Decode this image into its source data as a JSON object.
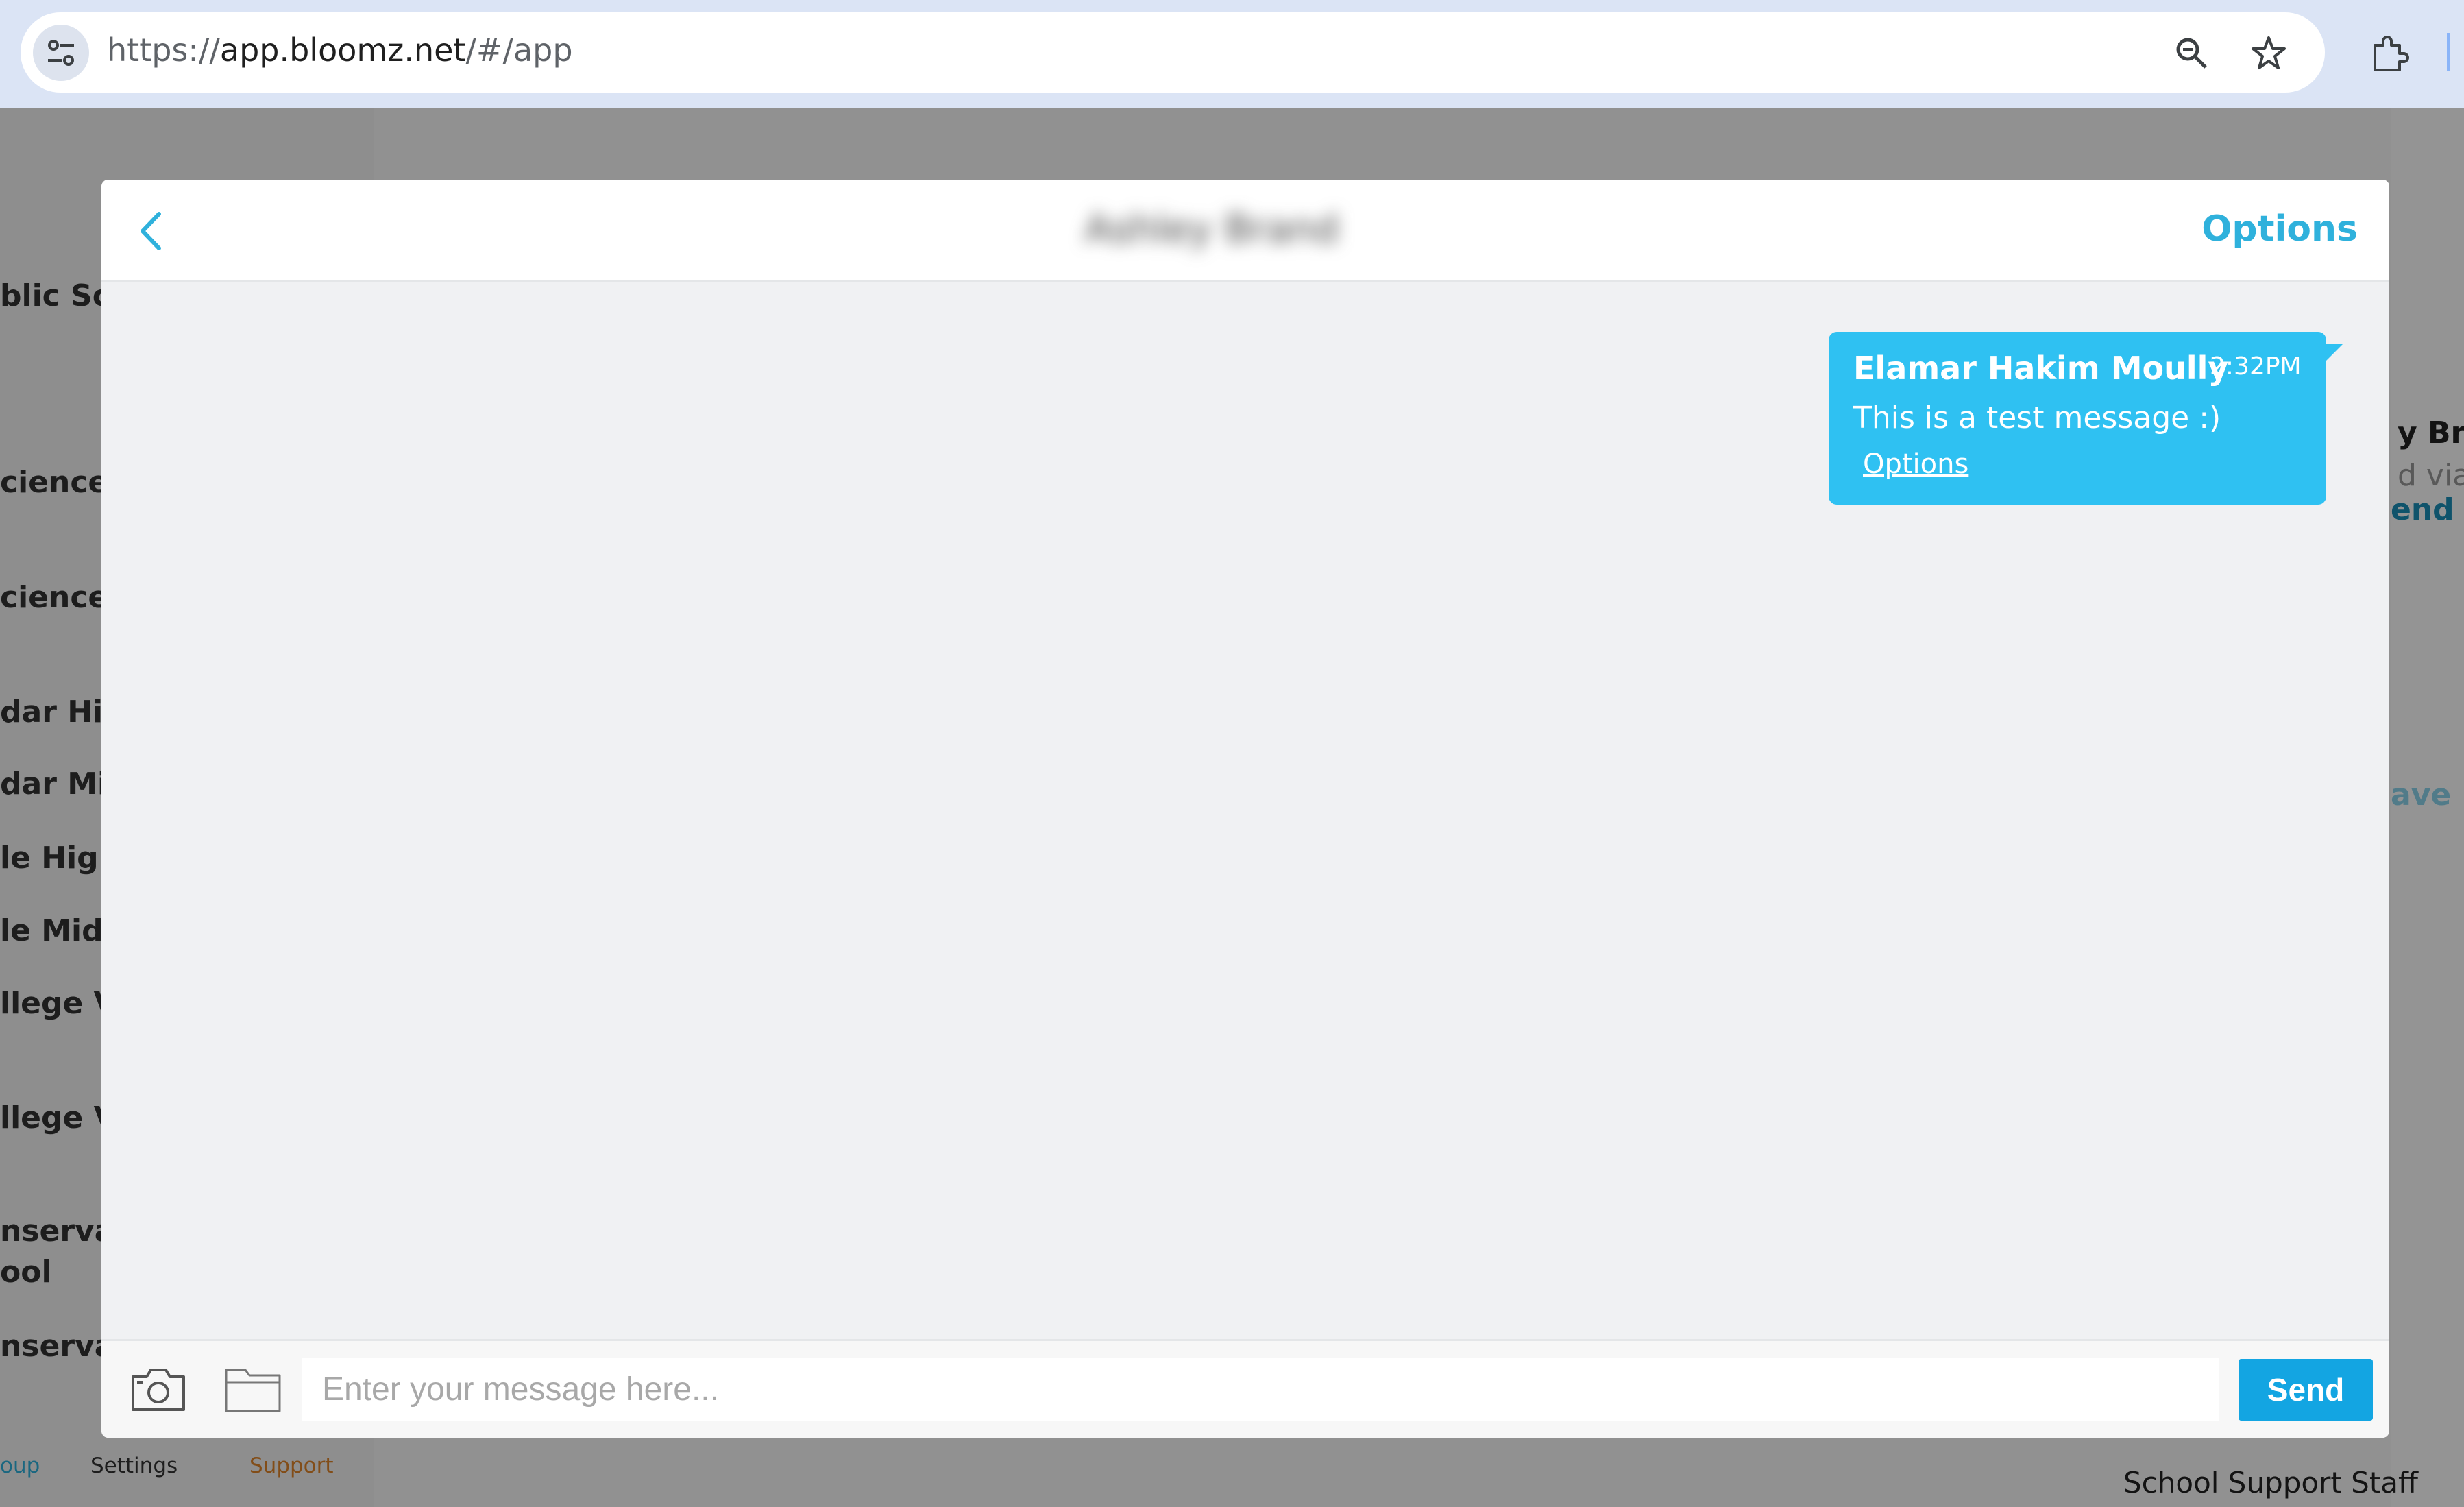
{
  "browser": {
    "url_scheme": "https://",
    "url_host": "app.bloomz.net",
    "url_rest": "/#/app"
  },
  "background": {
    "left_items": [
      "blic Sch",
      "cience a",
      "cience a",
      "dar Hig",
      "dar Mic",
      "le High",
      "le Midc",
      "llege V",
      "llege V",
      "nservat",
      "ool",
      "nservat"
    ],
    "right_fragments": [
      "y Bra",
      "d via",
      "end",
      "ave"
    ],
    "bottom_nav": {
      "group": "oup",
      "settings": "Settings",
      "support": "Support"
    },
    "support_staff": "School Support Staff"
  },
  "chat": {
    "contact_name": "Ashley Brand",
    "header_options": "Options",
    "messages": [
      {
        "sender": "Elamar Hakim Moully",
        "time": "2:32PM",
        "text": "This is a test message :)",
        "options": "Options"
      }
    ],
    "composer": {
      "placeholder": "Enter your message here...",
      "send_label": "Send"
    }
  },
  "colors": {
    "accent": "#2fb1dc",
    "bubble": "#2fc1f2",
    "send": "#13a5e2"
  }
}
